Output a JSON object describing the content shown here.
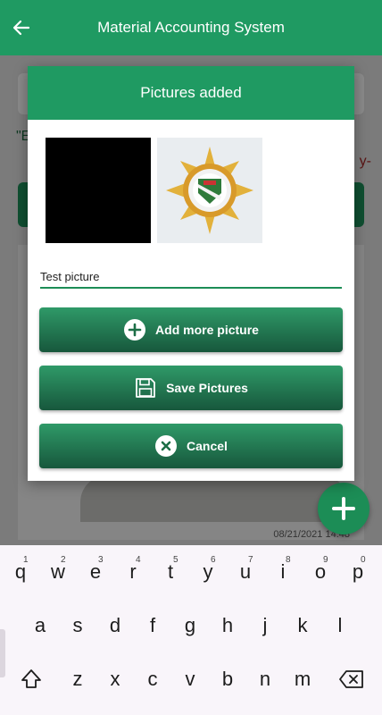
{
  "app": {
    "title": "Material Accounting System"
  },
  "background": {
    "quote_left": "\"E",
    "quote_right": "y-",
    "timestamp": "08/21/2021 14:48"
  },
  "dialog": {
    "title": "Pictures added",
    "caption_value": "Test picture",
    "buttons": {
      "add_more": "Add more picture",
      "save": "Save Pictures",
      "cancel": "Cancel"
    }
  },
  "keyboard": {
    "row1": [
      {
        "key": "q",
        "hint": "1"
      },
      {
        "key": "w",
        "hint": "2"
      },
      {
        "key": "e",
        "hint": "3"
      },
      {
        "key": "r",
        "hint": "4"
      },
      {
        "key": "t",
        "hint": "5"
      },
      {
        "key": "y",
        "hint": "6"
      },
      {
        "key": "u",
        "hint": "7"
      },
      {
        "key": "i",
        "hint": "8"
      },
      {
        "key": "o",
        "hint": "9"
      },
      {
        "key": "p",
        "hint": "0"
      }
    ],
    "row2": [
      "a",
      "s",
      "d",
      "f",
      "g",
      "h",
      "j",
      "k",
      "l"
    ],
    "row3": [
      "z",
      "x",
      "c",
      "v",
      "b",
      "n",
      "m"
    ]
  },
  "colors": {
    "primary": "#1f9a62",
    "button_dark": "#17573c"
  }
}
